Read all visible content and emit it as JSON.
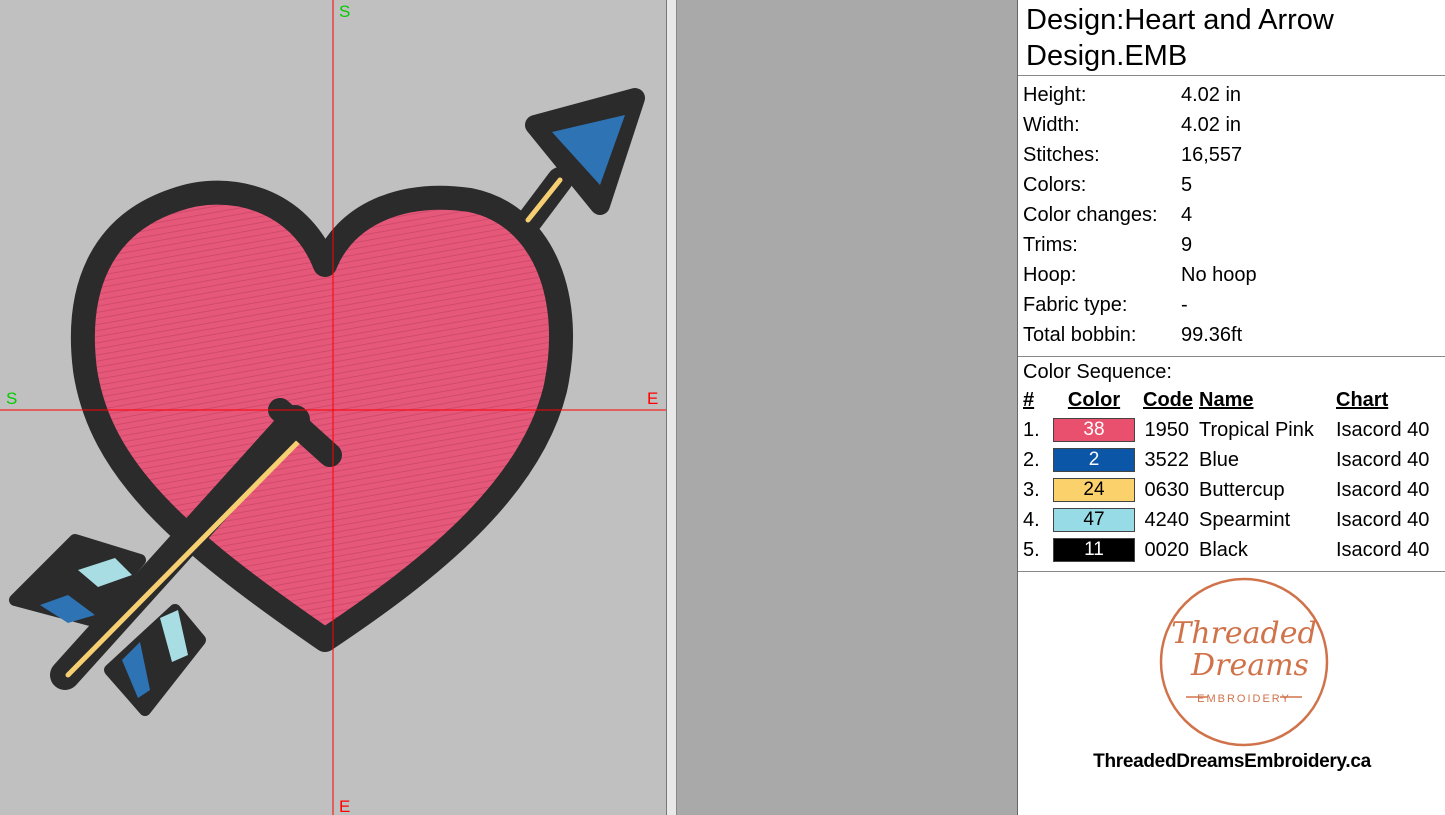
{
  "canvas": {
    "axis_labels": {
      "top": "S",
      "left": "S",
      "right": "E",
      "bottom": "E"
    },
    "colors": {
      "background": "#c0c0c0",
      "grid_line": "#ff0000",
      "start_label": "#00cc00",
      "end_label": "#ff0000"
    },
    "design_elements": [
      "heart",
      "arrow"
    ]
  },
  "panel": {
    "title": "Design:Heart and Arrow Design.EMB",
    "properties": [
      {
        "label": "Height:",
        "value": "4.02 in"
      },
      {
        "label": "Width:",
        "value": "4.02 in"
      },
      {
        "label": "Stitches:",
        "value": "16,557"
      },
      {
        "label": "Colors:",
        "value": "5"
      },
      {
        "label": "Color changes:",
        "value": "4"
      },
      {
        "label": "Trims:",
        "value": "9"
      },
      {
        "label": "Hoop:",
        "value": "No hoop"
      },
      {
        "label": "Fabric type:",
        "value": "-"
      },
      {
        "label": "Total bobbin:",
        "value": "99.36ft"
      }
    ],
    "color_sequence": {
      "title": "Color Sequence:",
      "headers": {
        "num": "#",
        "color": "Color",
        "code": "Code",
        "name": "Name",
        "chart": "Chart"
      },
      "rows": [
        {
          "num": "1.",
          "swatch": "38",
          "hex": "#e8506e",
          "text_color": "#ffffff",
          "code": "1950",
          "name": "Tropical Pink",
          "chart": "Isacord 40"
        },
        {
          "num": "2.",
          "swatch": "2",
          "hex": "#0b56a6",
          "text_color": "#ffffff",
          "code": "3522",
          "name": "Blue",
          "chart": "Isacord 40"
        },
        {
          "num": "3.",
          "swatch": "24",
          "hex": "#fbd16c",
          "text_color": "#000000",
          "code": "0630",
          "name": "Buttercup",
          "chart": "Isacord 40"
        },
        {
          "num": "4.",
          "swatch": "47",
          "hex": "#96dbe5",
          "text_color": "#000000",
          "code": "4240",
          "name": "Spearmint",
          "chart": "Isacord 40"
        },
        {
          "num": "5.",
          "swatch": "11",
          "hex": "#000000",
          "text_color": "#ffffff",
          "code": "0020",
          "name": "Black",
          "chart": "Isacord 40"
        }
      ]
    },
    "logo": {
      "line1": "Threaded",
      "line2": "Dreams",
      "line3": "EMBROIDERY",
      "url": "ThreadedDreamsEmbroidery.ca",
      "color": "#d0734b"
    }
  }
}
